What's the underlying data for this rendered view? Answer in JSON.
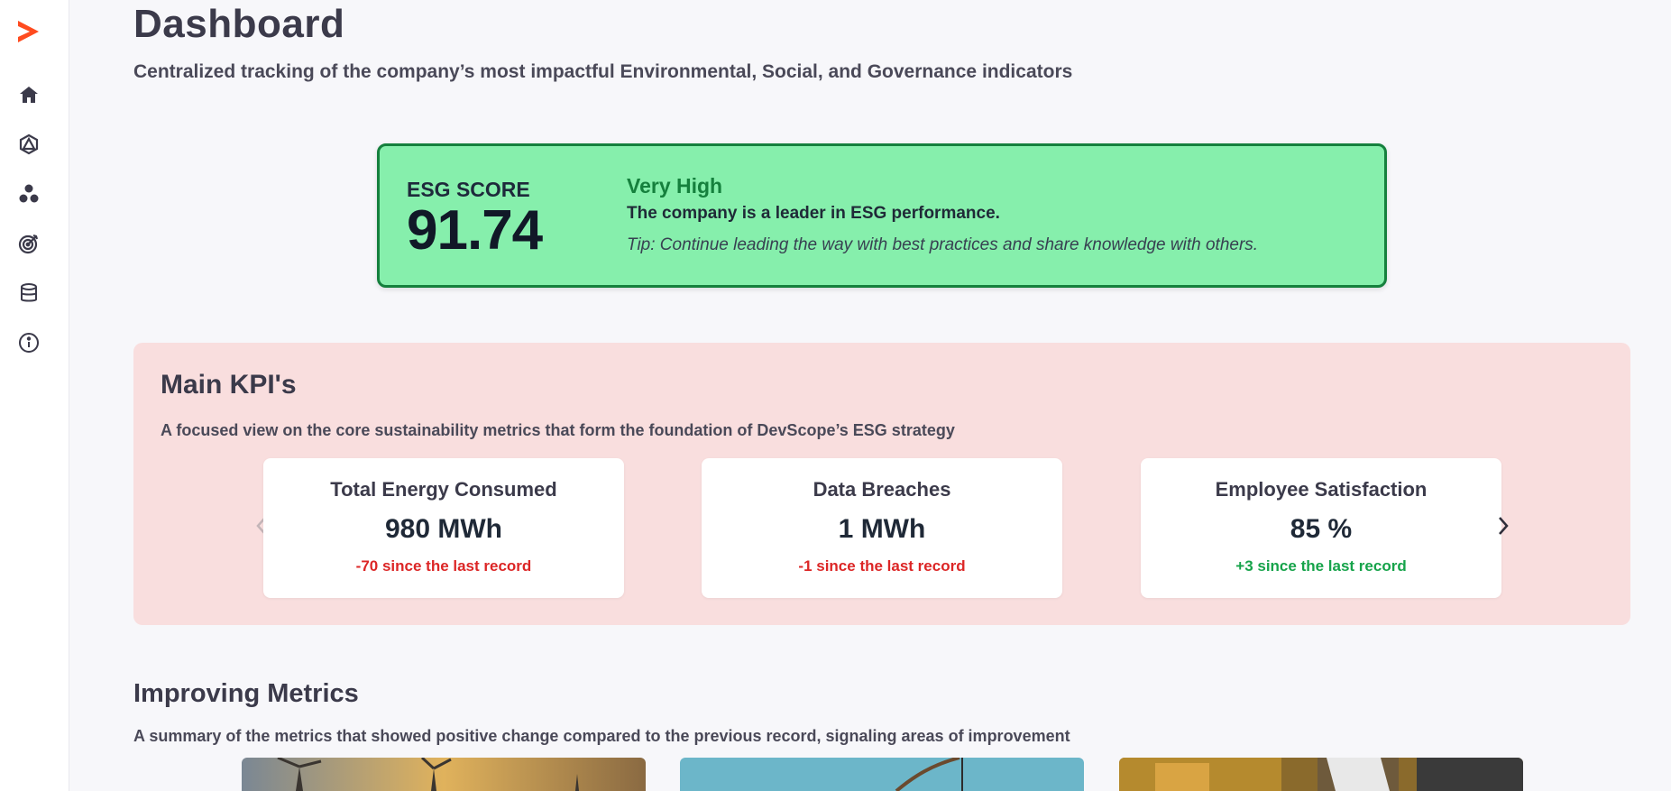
{
  "colors": {
    "brand": "#ff4b1f",
    "esg_bg": "#86efac",
    "esg_border": "#15803d",
    "kpi_bg": "#f9dede",
    "negative": "#dc2626",
    "positive": "#16a34a"
  },
  "sidebar": {
    "logo_icon": "chevron-logo",
    "items": [
      {
        "icon": "home-icon"
      },
      {
        "icon": "hexagon-network-icon"
      },
      {
        "icon": "hierarchy-icon"
      },
      {
        "icon": "target-icon"
      },
      {
        "icon": "database-icon"
      },
      {
        "icon": "info-icon"
      }
    ]
  },
  "header": {
    "title": "Dashboard",
    "subtitle": "Centralized tracking of the company’s most impactful Environmental, Social, and Governance indicators"
  },
  "esg": {
    "label": "ESG SCORE",
    "value": "91.74",
    "level": "Very High",
    "description": "The company is a leader in ESG performance.",
    "tip": "Tip: Continue leading the way with best practices and share knowledge with others."
  },
  "kpis": {
    "title": "Main KPI's",
    "subtitle": "A focused view on the core sustainability metrics that form the foundation of DevScope’s ESG strategy",
    "cards": [
      {
        "name": "Total Energy Consumed",
        "value": "980 MWh",
        "delta": "-70 since the last record",
        "trend": "negative"
      },
      {
        "name": "Data Breaches",
        "value": "1 MWh",
        "delta": "-1 since the last record",
        "trend": "negative"
      },
      {
        "name": "Employee Satisfaction",
        "value": "85 %",
        "delta": "+3 since the last record",
        "trend": "positive"
      }
    ]
  },
  "improving": {
    "title": "Improving Metrics",
    "subtitle": "A summary of the metrics that showed positive change compared to the previous record, signaling areas of improvement",
    "images": [
      "wind-turbines-image",
      "teal-plant-image",
      "warehouse-image"
    ]
  }
}
